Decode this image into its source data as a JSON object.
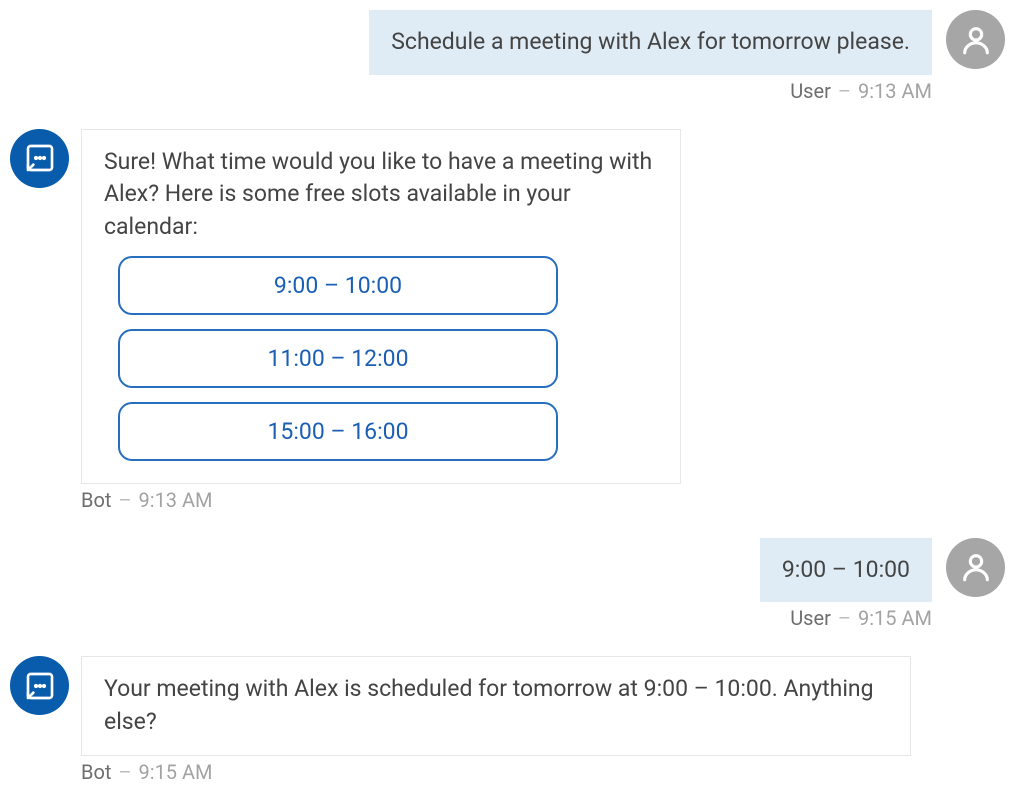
{
  "messages": [
    {
      "role": "user",
      "sender": "User",
      "time": "9:13 AM",
      "text": "Schedule a meeting with Alex for tomorrow please."
    },
    {
      "role": "bot",
      "sender": "Bot",
      "time": "9:13 AM",
      "text": "Sure! What time would you like to have a meeting with Alex? Here is some free slots available in your calendar:",
      "options": [
        "9:00 – 10:00",
        "11:00 – 12:00",
        "15:00 – 16:00"
      ]
    },
    {
      "role": "user",
      "sender": "User",
      "time": "9:15 AM",
      "text": "9:00 – 10:00"
    },
    {
      "role": "bot",
      "sender": "Bot",
      "time": "9:15 AM",
      "text": "Your meeting with Alex is scheduled for tomorrow at 9:00 – 10:00. Anything else?"
    }
  ],
  "colors": {
    "user_bubble_bg": "#dfecf5",
    "bot_avatar_bg": "#085cab",
    "user_avatar_bg": "#a6a6a6",
    "option_border": "#266fbe",
    "option_text": "#1a5fb4"
  },
  "icons": {
    "user": "person-icon",
    "bot": "chatbot-icon"
  }
}
